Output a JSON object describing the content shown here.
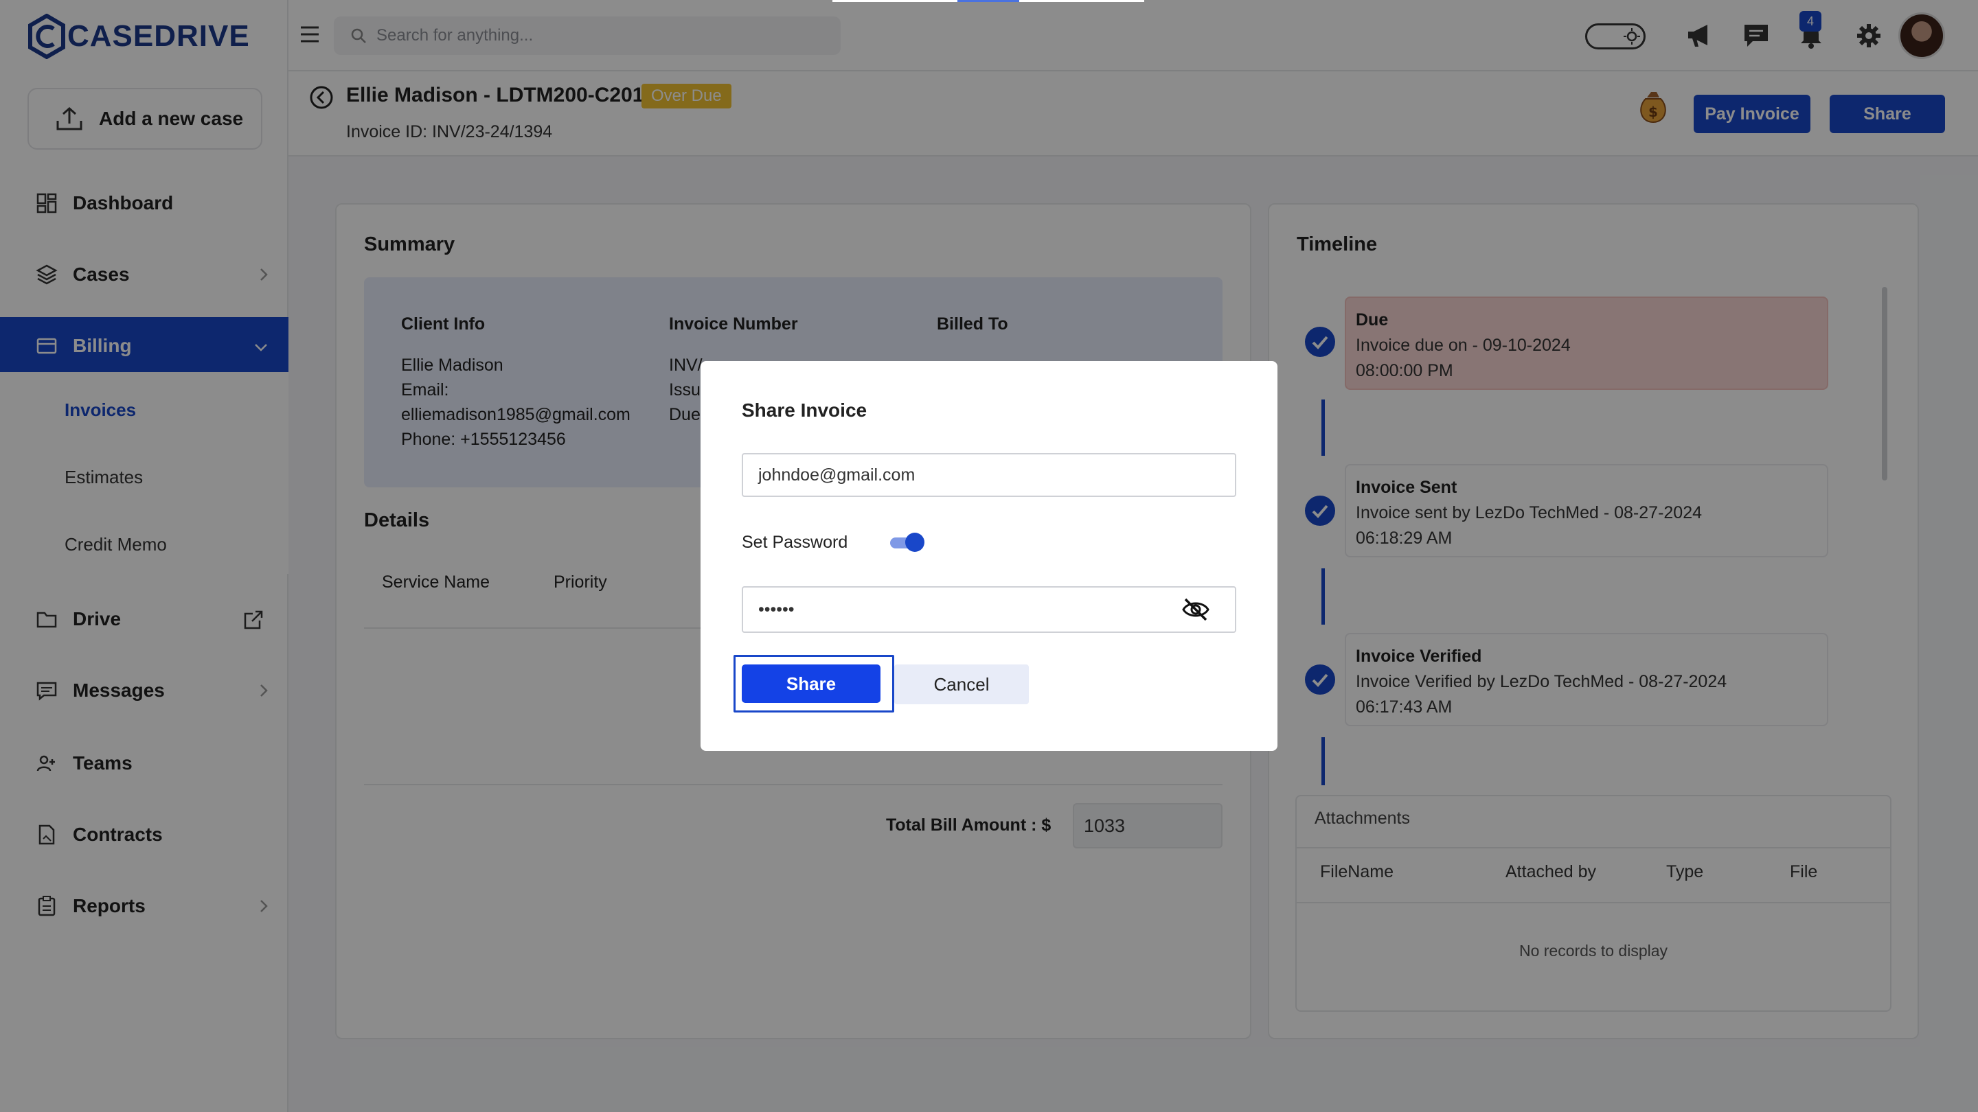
{
  "app": {
    "logo_text": "CASEDRIVE",
    "accent_color": "#1947c9",
    "search_placeholder": "Search for anything..."
  },
  "sidebar": {
    "add_case_label": "Add a new case",
    "items": [
      {
        "label": "Dashboard",
        "icon": "dashboard-icon"
      },
      {
        "label": "Cases",
        "icon": "layers-icon"
      },
      {
        "label": "Billing",
        "icon": "billing-icon",
        "active": true
      },
      {
        "label": "Drive",
        "icon": "folder-icon"
      },
      {
        "label": "Messages",
        "icon": "message-icon"
      },
      {
        "label": "Teams",
        "icon": "teams-icon"
      },
      {
        "label": "Contracts",
        "icon": "contract-icon"
      },
      {
        "label": "Reports",
        "icon": "report-icon"
      }
    ],
    "billing_sub": [
      {
        "label": "Invoices",
        "active": true
      },
      {
        "label": "Estimates"
      },
      {
        "label": "Credit Memo"
      }
    ]
  },
  "topbar": {
    "notification_count": "4"
  },
  "header": {
    "title": "Ellie Madison - LDTM200-C201",
    "status_badge": "Over Due",
    "invoice_id": "Invoice ID: INV/23-24/1394",
    "pay_button": "Pay Invoice",
    "share_button": "Share"
  },
  "summary": {
    "title": "Summary",
    "col_client": "Client Info",
    "col_invoice": "Invoice Number",
    "col_billed": "Billed To",
    "client_name": "Ellie Madison",
    "client_email_label": "Email:",
    "client_email": "elliemadison1985@gmail.com",
    "client_phone": "Phone: +1555123456",
    "invoice_line1": "INV/",
    "invoice_line2": "Issu",
    "invoice_line3": "Due"
  },
  "details": {
    "title": "Details",
    "columns": [
      "Service Name",
      "Priority"
    ],
    "total_label": "Total Bill Amount : $",
    "total_value": "1033"
  },
  "timeline": {
    "title": "Timeline",
    "events": [
      {
        "heading": "Due",
        "line1": "Invoice due on - 09-10-2024",
        "line2": "08:00:00 PM"
      },
      {
        "heading": "Invoice Sent",
        "line1": "Invoice sent by LezDo TechMed - 08-27-2024",
        "line2": "06:18:29 AM"
      },
      {
        "heading": "Invoice Verified",
        "line1": "Invoice Verified by LezDo TechMed - 08-27-2024",
        "line2": "06:17:43 AM"
      }
    ]
  },
  "attachments": {
    "title": "Attachments",
    "columns": [
      "FileName",
      "Attached by",
      "Type",
      "File"
    ],
    "empty_text": "No records to display"
  },
  "modal": {
    "title": "Share Invoice",
    "email_value": "johndoe@gmail.com",
    "set_password_label": "Set Password",
    "password_toggle_on": true,
    "password_value": "••••••",
    "share_label": "Share",
    "cancel_label": "Cancel"
  }
}
